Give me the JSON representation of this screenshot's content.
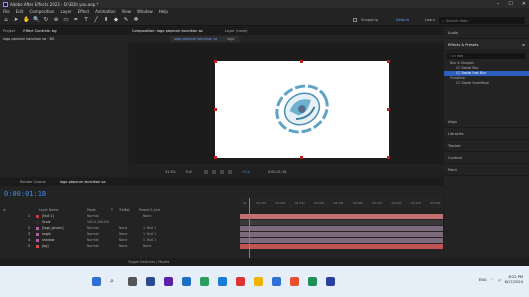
{
  "window": {
    "title": "Adobe After Effects 2023 - D:\\EDit you.aep *",
    "minimize_glyph": "–",
    "maximize_glyph": "☐",
    "close_glyph": "✕"
  },
  "menu": [
    "File",
    "Edit",
    "Composition",
    "Layer",
    "Effect",
    "Animation",
    "View",
    "Window",
    "Help"
  ],
  "toolbar": {
    "tools": [
      "⌂",
      "➤",
      "✋",
      "🔍",
      "↻",
      "⊕",
      "▭",
      "✒",
      "T",
      "╱",
      "⬆",
      "◆",
      "✎",
      "✤"
    ],
    "snapping_label": "Snapping",
    "workspace_default": "Default",
    "workspace_learn": "Learn",
    "workspace_standard": "Standard",
    "search_placeholder": "Search Help"
  },
  "project_panel": {
    "tab_project": "Project",
    "tab_effect_controls": "Effect Controls: bg",
    "line": "logo pepeum koncikan sa · BG"
  },
  "composition_panel": {
    "tab": "Composition: logo pepeum koncikan sa",
    "tab_lock": "Layer (none)",
    "subtab_comp": "logo pepeum koncikan sa",
    "subtab_logo": "logo",
    "zoom": "31.3%",
    "resolution": "Full",
    "timecode": "0:00:01:18",
    "exposure": "+0.0"
  },
  "right_panel": {
    "items": [
      "Audio",
      "Effects & Presets",
      "Align",
      "Libraries",
      "Tracker",
      "Content",
      "Paint"
    ],
    "search_value": "cc radi",
    "tree": [
      "Blur & Sharpen",
      "CC Radial Blur",
      "CC Radial Fast Blur",
      "Transition",
      "CC Radial ScaleWipe"
    ],
    "tree_selected_index": 2
  },
  "timeline": {
    "tab_render": "Render Queue",
    "tab_comp": "logo pepeum koncikan sa",
    "current_time": "0:00:01:18",
    "headers": [
      "#",
      "Layer Name",
      "Mode",
      "T",
      "TrkMat",
      "Parent & Link"
    ],
    "ruler": [
      "0s",
      "00:15f",
      "01:00f",
      "01:15f",
      "02:00f",
      "02:15f",
      "03:00f",
      "03:15f",
      "04:00f",
      "04:15f",
      "05:00f"
    ],
    "rows": [
      {
        "num": "1",
        "name": "[Null 1]",
        "mode": "Normal",
        "trk": "",
        "parent": "None",
        "label": "#c93b3b",
        "bar": "#c26f6f"
      },
      {
        "num": "",
        "name": "Scale",
        "mode": "100.0,100.0%",
        "trk": "",
        "parent": "",
        "label": "#2e2e2e",
        "bar": "#3a3a3a"
      },
      {
        "num": "2",
        "name": "[logo_ginsen]",
        "mode": "Normal",
        "trk": "None",
        "parent": "1. Null 1",
        "label": "#b25ea0",
        "bar": "#7c6b7c"
      },
      {
        "num": "3",
        "name": "angle",
        "mode": "Normal",
        "trk": "None",
        "parent": "1. Null 1",
        "label": "#b25ea0",
        "bar": "#7c6b7c"
      },
      {
        "num": "4",
        "name": "shadow",
        "mode": "Normal",
        "trk": "None",
        "parent": "1. Null 1",
        "label": "#b25ea0",
        "bar": "#7c6b7c"
      },
      {
        "num": "5",
        "name": "[bg]",
        "mode": "Normal",
        "trk": "None",
        "parent": "None",
        "label": "#d14b4b",
        "bar": "#c05353"
      }
    ],
    "footer": "Toggle Switches / Modes"
  },
  "taskbar": {
    "lang": "ENG",
    "time": "8:22 PM",
    "date": "6/17/2024"
  },
  "colors": {
    "accent_blue": "#3a8ff0",
    "canvas_bg": "#ffffff",
    "logo_blue": "#5fa4c6"
  }
}
